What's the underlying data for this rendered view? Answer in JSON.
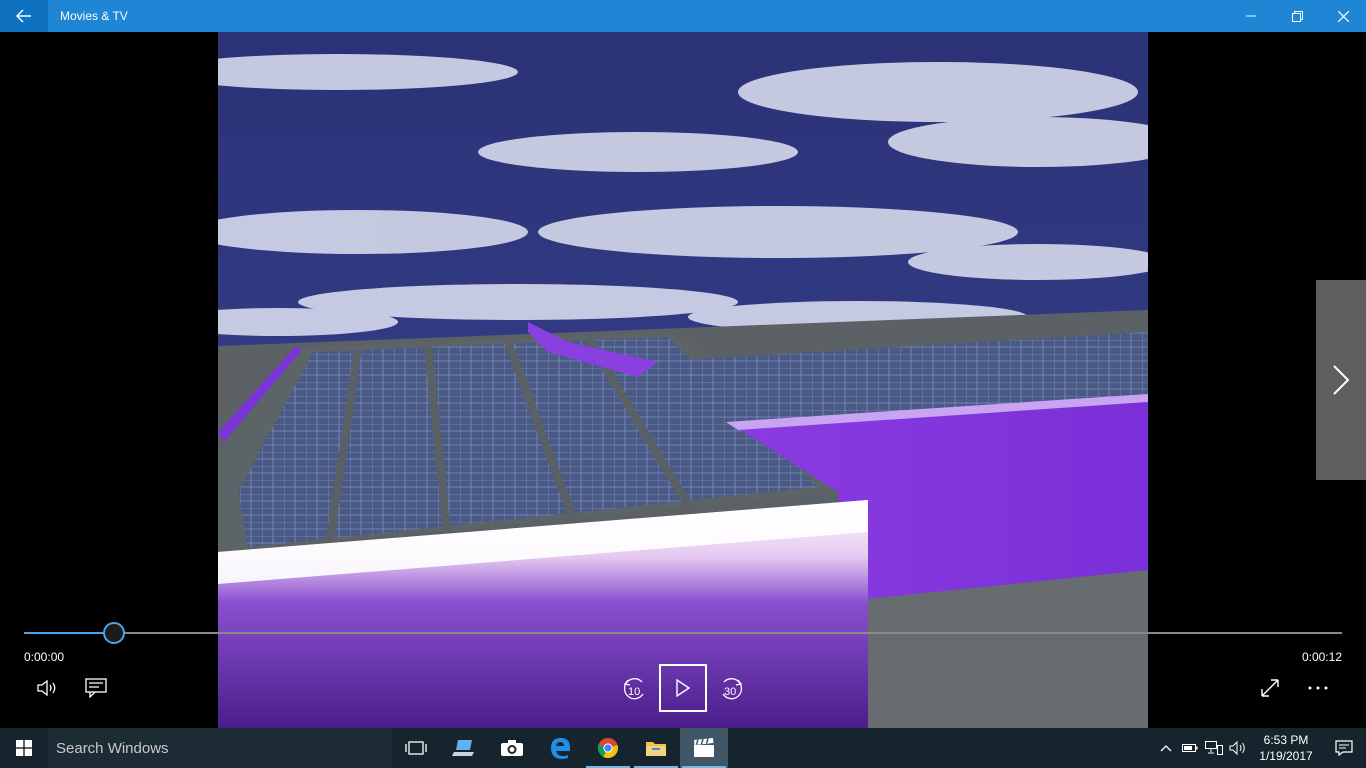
{
  "window": {
    "title": "Movies & TV"
  },
  "player": {
    "elapsed": "0:00:00",
    "duration": "0:00:12",
    "progress_fraction": 0.068,
    "skip_back_label": "10",
    "skip_forward_label": "30"
  },
  "taskbar": {
    "search_placeholder": "Search Windows",
    "time": "6:53 PM",
    "date": "1/19/2017",
    "apps": [
      "task-view",
      "laptop",
      "camera",
      "edge",
      "chrome",
      "file-explorer",
      "movies-tv"
    ]
  },
  "colors": {
    "accent": "#1f86d6",
    "timeline_fill": "#4aa3e8",
    "taskbar": "#15242d"
  }
}
